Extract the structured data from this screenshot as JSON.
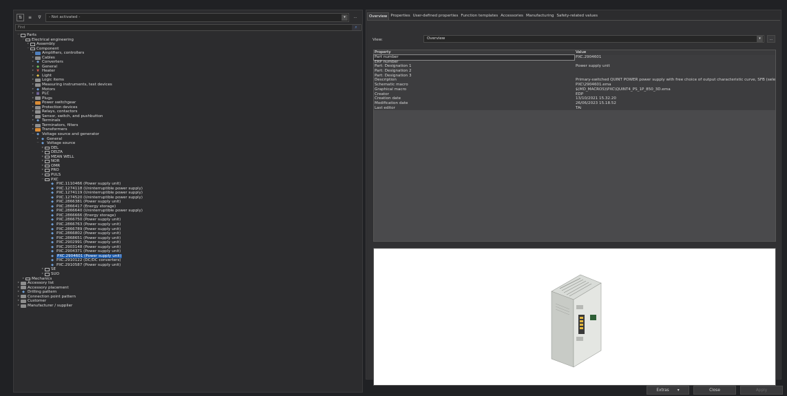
{
  "toolbar": {
    "filter_value": "- Not activated -",
    "more_label": "...",
    "find_placeholder": "Find"
  },
  "tree": [
    {
      "depth": 0,
      "exp": "−",
      "icon": "folder",
      "label": "Parts"
    },
    {
      "depth": 1,
      "exp": "−",
      "icon": "folder",
      "label": "Electrical engineering"
    },
    {
      "depth": 2,
      "exp": "▸",
      "icon": "folder",
      "label": "Assembly"
    },
    {
      "depth": 2,
      "exp": "−",
      "icon": "folder",
      "label": "Component"
    },
    {
      "depth": 3,
      "exp": "▸",
      "icon": "comp",
      "label": "Amplifiers, controllers"
    },
    {
      "depth": 3,
      "exp": "▸",
      "icon": "gray",
      "label": "Cables"
    },
    {
      "depth": 3,
      "exp": "▸",
      "icon": "dev",
      "label": "Converters"
    },
    {
      "depth": 3,
      "exp": "▸",
      "icon": "green",
      "label": "General"
    },
    {
      "depth": 3,
      "exp": "▸",
      "icon": "red",
      "label": "Heater"
    },
    {
      "depth": 3,
      "exp": "▸",
      "icon": "yellow",
      "label": "Light"
    },
    {
      "depth": 3,
      "exp": "▸",
      "icon": "gray",
      "label": "Logic items"
    },
    {
      "depth": 3,
      "exp": "▸",
      "icon": "gray",
      "label": "Measuring instruments, test devices"
    },
    {
      "depth": 3,
      "exp": "▸",
      "icon": "dev",
      "label": "Motors"
    },
    {
      "depth": 3,
      "exp": "▸",
      "icon": "pu",
      "label": "PLC"
    },
    {
      "depth": 3,
      "exp": "▸",
      "icon": "gray",
      "label": "Plugs"
    },
    {
      "depth": 3,
      "exp": "▸",
      "icon": "orange",
      "label": "Power switchgear"
    },
    {
      "depth": 3,
      "exp": "▸",
      "icon": "gray",
      "label": "Protection devices"
    },
    {
      "depth": 3,
      "exp": "▸",
      "icon": "gray",
      "label": "Relays, contactors"
    },
    {
      "depth": 3,
      "exp": "▸",
      "icon": "gray",
      "label": "Sensor, switch, and pushbutton"
    },
    {
      "depth": 3,
      "exp": "▸",
      "icon": "dev",
      "label": "Terminals"
    },
    {
      "depth": 3,
      "exp": "▸",
      "icon": "gray",
      "label": "Terminators, filters"
    },
    {
      "depth": 3,
      "exp": "▸",
      "icon": "orange",
      "label": "Transformers"
    },
    {
      "depth": 3,
      "exp": "−",
      "icon": "dev",
      "label": "Voltage source and generator"
    },
    {
      "depth": 4,
      "exp": "▸",
      "icon": "dev",
      "label": "General"
    },
    {
      "depth": 4,
      "exp": "−",
      "icon": "dev",
      "label": "Voltage source"
    },
    {
      "depth": 5,
      "exp": "▸",
      "icon": "folder",
      "label": "DEL"
    },
    {
      "depth": 5,
      "exp": "▸",
      "icon": "folder",
      "label": "DELTA"
    },
    {
      "depth": 5,
      "exp": "▸",
      "icon": "folder",
      "label": "MEAN WELL"
    },
    {
      "depth": 5,
      "exp": "▸",
      "icon": "folder",
      "label": "NOR"
    },
    {
      "depth": 5,
      "exp": "▸",
      "icon": "folder",
      "label": "OMR"
    },
    {
      "depth": 5,
      "exp": "▸",
      "icon": "folder",
      "label": "PRO"
    },
    {
      "depth": 5,
      "exp": "▸",
      "icon": "folder",
      "label": "PULS"
    },
    {
      "depth": 5,
      "exp": "−",
      "icon": "folder",
      "label": "PXC"
    },
    {
      "depth": 6,
      "exp": "",
      "icon": "dev",
      "label": "PXC.1110466 (Power supply unit)"
    },
    {
      "depth": 6,
      "exp": "",
      "icon": "dev",
      "label": "PXC.1274118 (Uninterruptible power supply)"
    },
    {
      "depth": 6,
      "exp": "",
      "icon": "dev",
      "label": "PXC.1274119 (Uninterruptible power supply)"
    },
    {
      "depth": 6,
      "exp": "",
      "icon": "dev",
      "label": "PXC.1274520 (Uninterruptible power supply)"
    },
    {
      "depth": 6,
      "exp": "",
      "icon": "dev",
      "label": "PXC.2866381 (Power supply unit)"
    },
    {
      "depth": 6,
      "exp": "",
      "icon": "dev",
      "label": "PXC.2866417 (Energy storage)"
    },
    {
      "depth": 6,
      "exp": "",
      "icon": "dev",
      "label": "PXC.2866640 (Uninterruptible power supply)"
    },
    {
      "depth": 6,
      "exp": "",
      "icon": "dev",
      "label": "PXC.2866666 (Energy storage)"
    },
    {
      "depth": 6,
      "exp": "",
      "icon": "dev",
      "label": "PXC.2866750 (Power supply unit)"
    },
    {
      "depth": 6,
      "exp": "",
      "icon": "dev",
      "label": "PXC.2866763 (Power supply unit)"
    },
    {
      "depth": 6,
      "exp": "",
      "icon": "dev",
      "label": "PXC.2866789 (Power supply unit)"
    },
    {
      "depth": 6,
      "exp": "",
      "icon": "dev",
      "label": "PXC.2866802 (Power supply unit)"
    },
    {
      "depth": 6,
      "exp": "",
      "icon": "dev",
      "label": "PXC.2868651 (Power supply unit)"
    },
    {
      "depth": 6,
      "exp": "",
      "icon": "dev",
      "label": "PXC.2902991 (Power supply unit)"
    },
    {
      "depth": 6,
      "exp": "",
      "icon": "dev",
      "label": "PXC.2903148 (Power supply unit)"
    },
    {
      "depth": 6,
      "exp": "",
      "icon": "dev",
      "label": "PXC.2904371 (Power supply unit)"
    },
    {
      "depth": 6,
      "exp": "",
      "icon": "dev",
      "label": "PXC.2904601 (Power supply unit)",
      "selected": true
    },
    {
      "depth": 6,
      "exp": "",
      "icon": "dev",
      "label": "PXC.2910122 (DC/DC converters)"
    },
    {
      "depth": 6,
      "exp": "",
      "icon": "dev",
      "label": "PXC.2910587 (Power supply unit)"
    },
    {
      "depth": 5,
      "exp": "▸",
      "icon": "folder",
      "label": "SE"
    },
    {
      "depth": 5,
      "exp": "▸",
      "icon": "folder",
      "label": "SUO"
    },
    {
      "depth": 1,
      "exp": "▸",
      "icon": "folder",
      "label": "Mechanics"
    },
    {
      "depth": 0,
      "exp": "▸",
      "icon": "gray",
      "label": "Accessory list"
    },
    {
      "depth": 0,
      "exp": "▸",
      "icon": "gray",
      "label": "Accessory placement"
    },
    {
      "depth": 0,
      "exp": "▸",
      "icon": "dev",
      "label": "Drilling pattern"
    },
    {
      "depth": 0,
      "exp": "▸",
      "icon": "gray",
      "label": "Connection point pattern"
    },
    {
      "depth": 0,
      "exp": "▸",
      "icon": "gray",
      "label": "Customer"
    },
    {
      "depth": 0,
      "exp": "▸",
      "icon": "gray",
      "label": "Manufacturer / supplier"
    }
  ],
  "tabs": [
    "Overview",
    "Properties",
    "User-defined properties",
    "Function templates",
    "Accessories",
    "Manufacturing",
    "Safety-related values"
  ],
  "view": {
    "label": "View:",
    "value": "Overview",
    "more": "..."
  },
  "props": {
    "header": {
      "name": "Property",
      "value": "Value"
    },
    "rows": [
      {
        "name": "Part number",
        "value": "PXC.2904601"
      },
      {
        "name": "ERP number",
        "value": ""
      },
      {
        "name": "Part: Designation 1",
        "value": "Power supply unit"
      },
      {
        "name": "Part: Designation 2",
        "value": ""
      },
      {
        "name": "Part: Designation 3",
        "value": ""
      },
      {
        "name": "Description",
        "value": "Primary-switched QUINT POWER power supply with free choice of output characteristic curve, SFB (selective f..."
      },
      {
        "name": "Schematic macro",
        "value": "PXC\\2904601.ema"
      },
      {
        "name": "Graphical macro",
        "value": "$(MD_MACROS)\\PXC\\QUINT4_PS_1P_850_3D.ema"
      },
      {
        "name": "Creator",
        "value": "EDP"
      },
      {
        "name": "Creation date",
        "value": "13/10/2021 15.32.20"
      },
      {
        "name": "Modification date",
        "value": "26/06/2023 15.18.52"
      },
      {
        "name": "Last editor",
        "value": "TAi"
      }
    ]
  },
  "buttons": {
    "extras": "Extras",
    "close": "Close",
    "apply": "Apply"
  }
}
